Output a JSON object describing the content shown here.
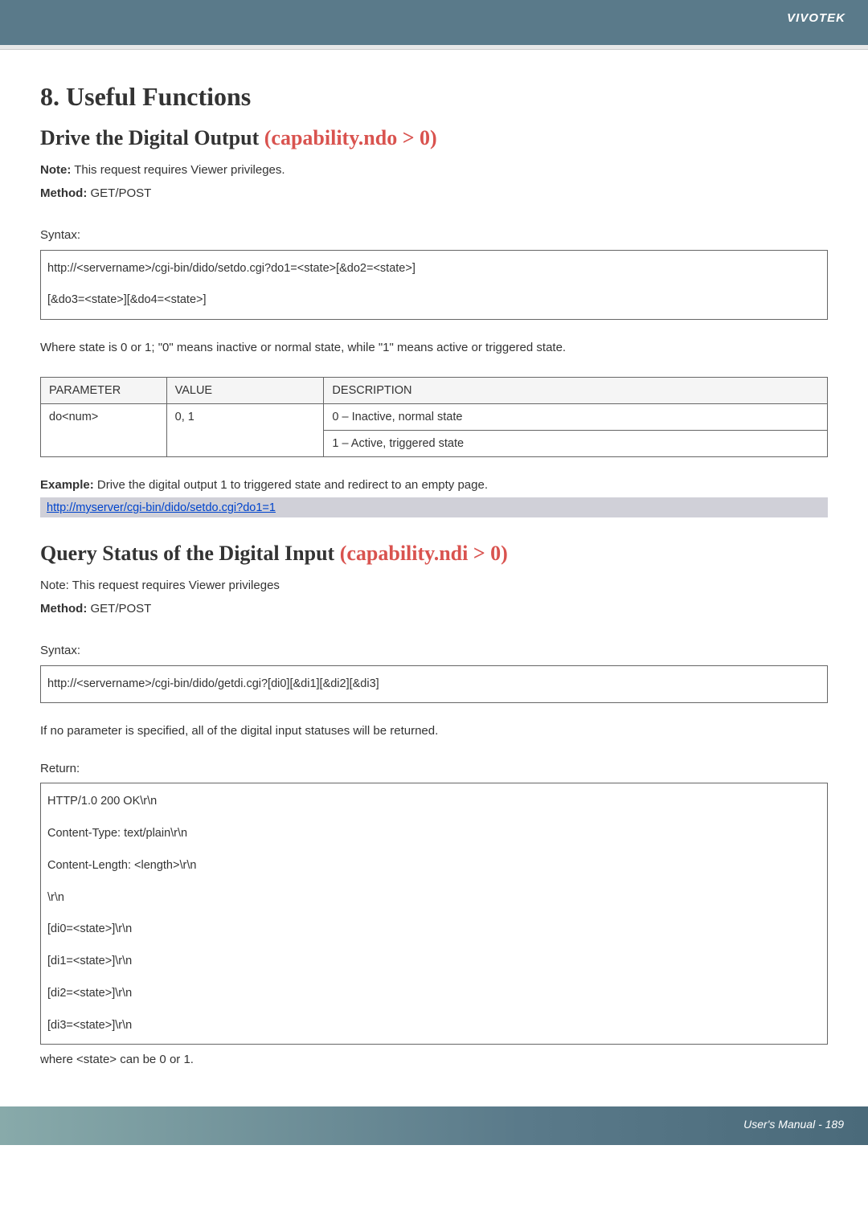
{
  "header": {
    "brand": "VIVOTEK"
  },
  "section1": {
    "heading": "8. Useful Functions",
    "sub_heading": "Drive the Digital Output ",
    "sub_heading_cap": "(capability.ndo > 0)",
    "note_label": "Note:",
    "note_text": " This request requires Viewer privileges.",
    "method_label": "Method:",
    "method_text": " GET/POST",
    "syntax_label": "Syntax:",
    "syntax_line1": "http://<servername>/cgi-bin/dido/setdo.cgi?do1=<state>[&do2=<state>]",
    "syntax_line2": "[&do3=<state>][&do4=<state>]",
    "where_text": "Where state is 0 or 1; \"0\" means inactive or normal state, while \"1\" means active or triggered state.",
    "table": {
      "h1": "PARAMETER",
      "h2": "VALUE",
      "h3": "DESCRIPTION",
      "r1c1": "do<num>",
      "r1c2": "0, 1",
      "r1c3a": "0 – Inactive, normal state",
      "r1c3b": "1 – Active, triggered state"
    },
    "example_label": "Example:",
    "example_text": " Drive the digital output 1 to triggered state and redirect to an empty page.",
    "example_link": "http://myserver/cgi-bin/dido/setdo.cgi?do1=1"
  },
  "section2": {
    "sub_heading": "Query Status of the Digital Input ",
    "sub_heading_cap": "(capability.ndi > 0)",
    "note_text": "Note: This request requires Viewer privileges",
    "method_label": "Method:",
    "method_text": " GET/POST",
    "syntax_label": "Syntax:",
    "syntax_line1": "http://<servername>/cgi-bin/dido/getdi.cgi?[di0][&di1][&di2][&di3]",
    "if_text": "If no parameter is specified, all of the digital input statuses will be returned.",
    "return_label": "Return:",
    "ret_l1": "HTTP/1.0 200 OK\\r\\n",
    "ret_l2": "Content-Type: text/plain\\r\\n",
    "ret_l3": "Content-Length: <length>\\r\\n",
    "ret_l4": "\\r\\n",
    "ret_l5": "[di0=<state>]\\r\\n",
    "ret_l6": "[di1=<state>]\\r\\n",
    "ret_l7": "[di2=<state>]\\r\\n",
    "ret_l8": "[di3=<state>]\\r\\n",
    "where_text": "where <state> can be 0 or 1."
  },
  "footer": {
    "page": "User's Manual - 189"
  }
}
